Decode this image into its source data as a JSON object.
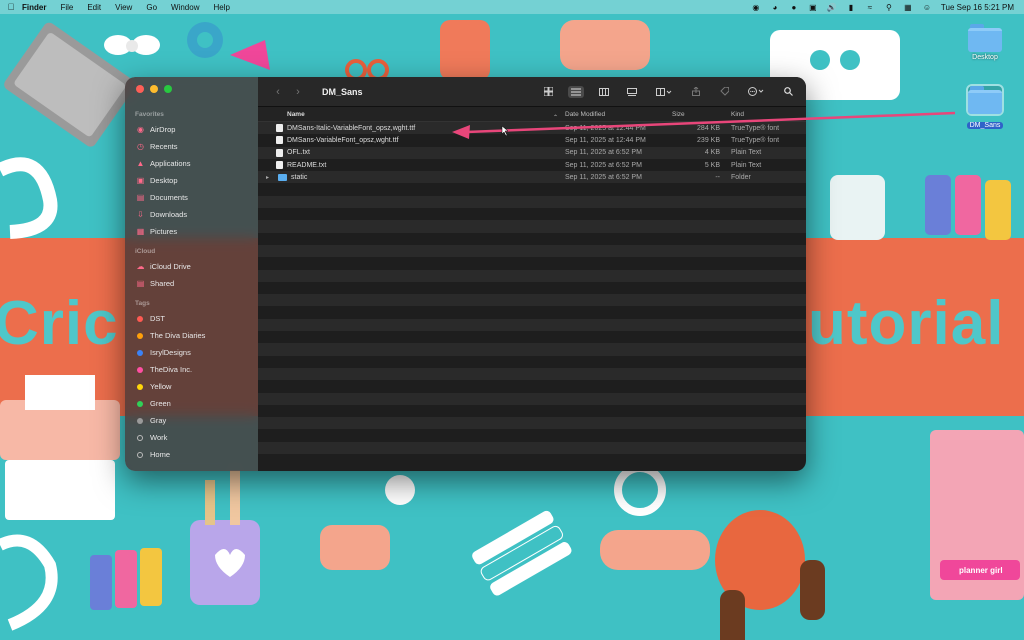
{
  "menubar": {
    "app": "Finder",
    "items": [
      "File",
      "Edit",
      "View",
      "Go",
      "Window",
      "Help"
    ],
    "clock": "Tue Sep 16  5:21 PM"
  },
  "desktop": {
    "icons": [
      {
        "label": "Desktop"
      },
      {
        "label": "DM_Sans"
      }
    ]
  },
  "wallpaper": {
    "text_left": "Cric",
    "text_right": "utorial",
    "sticker": "planner girl"
  },
  "finder": {
    "title": "DM_Sans",
    "sidebar": {
      "favorites_label": "Favorites",
      "favorites": [
        {
          "label": "AirDrop",
          "icon": "airdrop-icon"
        },
        {
          "label": "Recents",
          "icon": "clock-icon"
        },
        {
          "label": "Applications",
          "icon": "applications-icon"
        },
        {
          "label": "Desktop",
          "icon": "desktop-icon"
        },
        {
          "label": "Documents",
          "icon": "document-icon"
        },
        {
          "label": "Downloads",
          "icon": "download-icon"
        },
        {
          "label": "Pictures",
          "icon": "pictures-icon"
        }
      ],
      "icloud_label": "iCloud",
      "icloud": [
        {
          "label": "iCloud Drive",
          "icon": "cloud-icon"
        },
        {
          "label": "Shared",
          "icon": "shared-folder-icon"
        }
      ],
      "tags_label": "Tags",
      "tags": [
        {
          "label": "DST",
          "color": "#ff5a52"
        },
        {
          "label": "The Diva Diaries",
          "color": "#ff9f0a"
        },
        {
          "label": "IsrylDesigns",
          "color": "#3b82f6"
        },
        {
          "label": "TheDiva Inc.",
          "color": "#ff4fa3"
        },
        {
          "label": "Yellow",
          "color": "#ffd60a"
        },
        {
          "label": "Green",
          "color": "#30d158"
        },
        {
          "label": "Gray",
          "color": "#9a9a9a"
        },
        {
          "label": "Work",
          "color": "transparent"
        },
        {
          "label": "Home",
          "color": "transparent"
        }
      ]
    },
    "columns": {
      "name": "Name",
      "date": "Date Modified",
      "size": "Size",
      "kind": "Kind"
    },
    "files": [
      {
        "name": "DMSans-Italic-VariableFont_opsz,wght.ttf",
        "date": "Sep 11, 2025 at 12:44 PM",
        "size": "284 KB",
        "kind": "TrueType® font",
        "type": "file"
      },
      {
        "name": "DMSans-VariableFont_opsz,wght.ttf",
        "date": "Sep 11, 2025 at 12:44 PM",
        "size": "239 KB",
        "kind": "TrueType® font",
        "type": "file"
      },
      {
        "name": "OFL.txt",
        "date": "Sep 11, 2025 at 6:52 PM",
        "size": "4 KB",
        "kind": "Plain Text",
        "type": "file"
      },
      {
        "name": "README.txt",
        "date": "Sep 11, 2025 at 6:52 PM",
        "size": "5 KB",
        "kind": "Plain Text",
        "type": "file"
      },
      {
        "name": "static",
        "date": "Sep 11, 2025 at 6:52 PM",
        "size": "--",
        "kind": "Folder",
        "type": "folder"
      }
    ],
    "empty_rows": 22
  },
  "colors": {
    "wallpaper_teal": "#3fc1c4",
    "wallpaper_coral": "#ec6e4c",
    "annotation_arrow": "#e8467a"
  }
}
